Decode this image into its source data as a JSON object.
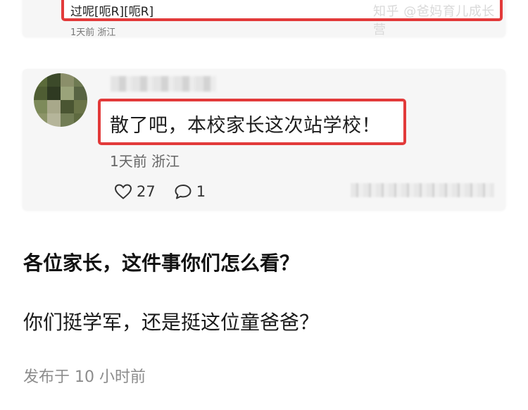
{
  "top_comment": {
    "text": "过呢[呃R][呃R]",
    "meta": "1天前 浙江",
    "watermark": "知乎 @爸妈育儿成长营"
  },
  "main_comment": {
    "text": "散了吧，本校家长这次站学校！",
    "meta": "1天前 浙江",
    "likes": "27",
    "replies": "1",
    "icons": {
      "like": "heart-outline-icon",
      "reply": "speech-bubble-icon"
    }
  },
  "article": {
    "heading": "各位家长，这件事你们怎么看？",
    "question": "你们挺学军，还是挺这位童爸爸？",
    "footer": "发布于  10 小时前"
  },
  "colors": {
    "highlight_border": "#e23a3a",
    "card_background": "#f6f6f6",
    "footer_text": "#8c8c8c"
  }
}
